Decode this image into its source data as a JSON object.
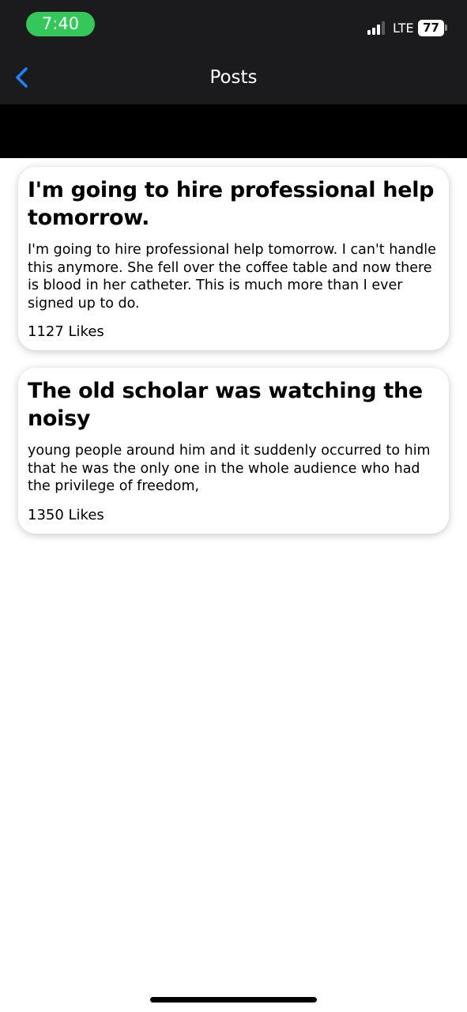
{
  "status_bar": {
    "time": "7:40",
    "network": "LTE",
    "battery": "77",
    "accent_color": "#34c759"
  },
  "nav": {
    "title": "Posts",
    "back_icon": "chevron-left-icon",
    "accent_color": "#1a84ff"
  },
  "posts": [
    {
      "title": "I'm going to hire professional help tomorrow.",
      "body": "I'm going to hire professional help tomorrow. I can't handle this anymore. She fell over the coffee table and now there is blood in her catheter. This is much more than I ever signed up to do.",
      "likes": "1127 Likes"
    },
    {
      "title": "The old scholar was watching the noisy",
      "body": "young people around him and it suddenly occurred to him that he was the only one in the whole audience who had the privilege of freedom,",
      "likes": "1350 Likes"
    }
  ]
}
